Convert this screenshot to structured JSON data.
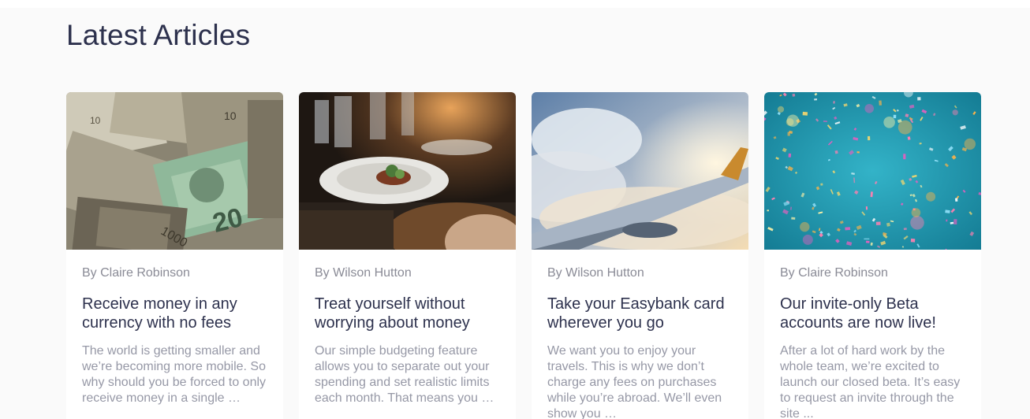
{
  "section": {
    "heading": "Latest Articles"
  },
  "articles": [
    {
      "image": "money-photo",
      "author": "By Claire Robinson",
      "title": "Receive money in any currency with no fees",
      "excerpt": "The world is getting smaller and we’re becoming more mobile. So why should you be forced to only receive money in a single …"
    },
    {
      "image": "restaurant-photo",
      "author": "By Wilson Hutton",
      "title": "Treat yourself without worrying about money",
      "excerpt": "Our simple budgeting feature allows you to separate out your spending and set realistic limits each month. That means you …"
    },
    {
      "image": "plane-wing-photo",
      "author": "By Wilson Hutton",
      "title": "Take your Easybank card wherever you go",
      "excerpt": "We want you to enjoy your travels. This is why we don’t charge any fees on purchases while you’re abroad. We’ll even show you …"
    },
    {
      "image": "confetti-photo",
      "author": "By Claire Robinson",
      "title": "Our invite-only Beta accounts are now live!",
      "excerpt": "After a lot of hard work by the whole team, we’re excited to launch our closed beta. It’s easy to request an invite through the site ..."
    }
  ]
}
